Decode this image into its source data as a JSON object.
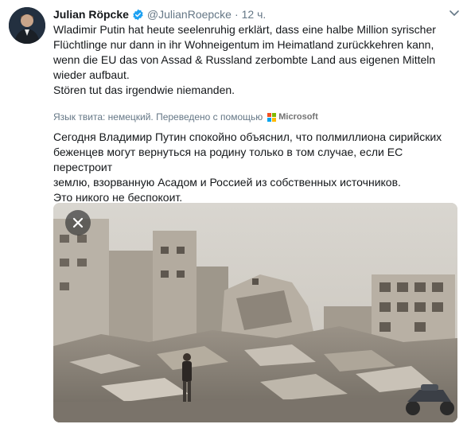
{
  "author": {
    "name": "Julian Röpcke",
    "handle": "@JulianRoepcke",
    "separator": "·",
    "time": "12 ч."
  },
  "tweet": {
    "text": "Wladimir Putin hat heute seelenruhig erklärt, dass eine halbe Million syrischer\nFlüchtlinge nur dann in ihr Wohneigentum im Heimatland zurückkehren kann,\nwenn die EU das von Assad & Russland zerbombte Land aus eigenen Mitteln\nwieder aufbaut.\nStören tut das irgendwie niemanden."
  },
  "translation": {
    "note": "Язык твита: немецкий. Переведено с помощью",
    "provider": "Microsoft",
    "text": "Сегодня Владимир Путин спокойно объяснил, что полмиллиона сирийских\nбеженцев могут вернуться на родину только в том случае, если ЕС перестроит\nземлю, взорванную Асадом и Россией из собственных источников.\nЭто никого не беспокоит."
  },
  "icons": {
    "verified": "verified-badge-icon",
    "menu": "chevron-down-icon",
    "close": "close-icon",
    "microsoft": "microsoft-logo-icon"
  },
  "colors": {
    "verified": "#1da1f2",
    "secondary_text": "#657786",
    "ms_red": "#f25022",
    "ms_green": "#7fba00",
    "ms_blue": "#00a4ef",
    "ms_yellow": "#ffb900"
  }
}
